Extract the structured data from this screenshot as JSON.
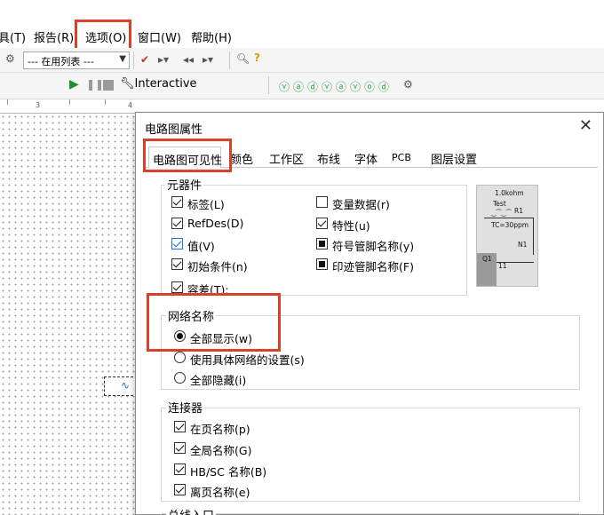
{
  "menubar": {
    "items": [
      {
        "label": "具(T)"
      },
      {
        "label": "报告(R)"
      },
      {
        "label": "选项(O)"
      },
      {
        "label": "窗口(W)"
      },
      {
        "label": "帮助(H)"
      }
    ]
  },
  "toolbar": {
    "list_combo_value": "--- 在用列表 ---",
    "interactive_label": "Interactive"
  },
  "ruler": {
    "ticks": [
      "3",
      "4"
    ]
  },
  "dialog": {
    "title": "电路图属性",
    "tabs": [
      "电路图可见性",
      "颜色",
      "工作区",
      "布线",
      "字体",
      "PCB",
      "图层设置"
    ],
    "component_group": {
      "label": "元器件",
      "left_items": [
        {
          "label": "标签(L)",
          "state": "checked"
        },
        {
          "label": "RefDes(D)",
          "state": "checked"
        },
        {
          "label": "值(V)",
          "state": "checked-blue"
        },
        {
          "label": "初始条件(n)",
          "state": "checked"
        },
        {
          "label": "容差(T):",
          "state": "checked"
        }
      ],
      "right_items": [
        {
          "label": "变量数据(r)",
          "state": "unchecked"
        },
        {
          "label": "特性(u)",
          "state": "checked"
        },
        {
          "label": "符号管脚名称(y)",
          "state": "square"
        },
        {
          "label": "印迹管脚名称(F)",
          "state": "square"
        }
      ]
    },
    "preview": {
      "resistance": "1.0kohm",
      "test": "Test",
      "r_ref": "R1",
      "tc": "TC=30ppm",
      "node": "N1",
      "q_ref": "Q1",
      "pin": "11"
    },
    "net_group": {
      "label": "网络名称",
      "options": [
        {
          "label": "全部显示(w)",
          "checked": true
        },
        {
          "label": "使用具体网络的设置(s)",
          "checked": false
        },
        {
          "label": "全部隐藏(i)",
          "checked": false
        }
      ]
    },
    "connector_group": {
      "label": "连接器",
      "items": [
        {
          "label": "在页名称(p)",
          "state": "checked"
        },
        {
          "label": "全局名称(G)",
          "state": "checked"
        },
        {
          "label": "HB/SC 名称(B)",
          "state": "checked"
        },
        {
          "label": "离页名称(e)",
          "state": "checked"
        }
      ]
    },
    "bus_group": {
      "label": "总线入口"
    }
  },
  "colors": {
    "highlight": "#d9412f",
    "check_blue": "#1a73e8"
  }
}
